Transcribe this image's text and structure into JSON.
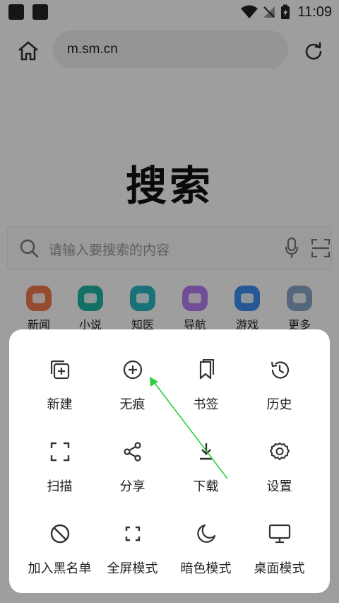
{
  "status_bar": {
    "time": "11:09"
  },
  "address_bar": {
    "url": "m.sm.cn"
  },
  "page": {
    "logo": "搜索",
    "search_placeholder": "请输入要搜索的内容",
    "quick_links": [
      {
        "label": "新闻",
        "color": "#f07a4e"
      },
      {
        "label": "小说",
        "color": "#1fb5a3"
      },
      {
        "label": "知医",
        "color": "#29b9c4"
      },
      {
        "label": "导航",
        "color": "#b37ff0"
      },
      {
        "label": "游戏",
        "color": "#3c8ff0"
      },
      {
        "label": "更多",
        "color": "#8aa6c6"
      }
    ]
  },
  "menu": {
    "items": [
      {
        "label": "新建",
        "icon": "new-tab-icon"
      },
      {
        "label": "无痕",
        "icon": "incognito-plus-icon"
      },
      {
        "label": "书签",
        "icon": "bookmark-icon"
      },
      {
        "label": "历史",
        "icon": "history-icon"
      },
      {
        "label": "扫描",
        "icon": "scan-icon"
      },
      {
        "label": "分享",
        "icon": "share-icon"
      },
      {
        "label": "下载",
        "icon": "download-icon"
      },
      {
        "label": "设置",
        "icon": "gear-icon"
      },
      {
        "label": "加入黑名单",
        "icon": "block-icon"
      },
      {
        "label": "全屏模式",
        "icon": "fullscreen-icon"
      },
      {
        "label": "暗色模式",
        "icon": "moon-icon"
      },
      {
        "label": "桌面模式",
        "icon": "desktop-icon"
      }
    ]
  },
  "annotation": {
    "arrow_color": "#2ecc40"
  }
}
